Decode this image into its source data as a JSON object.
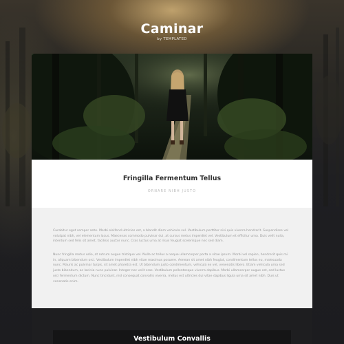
{
  "header": {
    "title": "Caminar",
    "byline": "by TEMPLATED"
  },
  "hero": {
    "image": "woman-walking-forest-path-photo"
  },
  "intro": {
    "title": "Fringilla Fermentum Tellus",
    "subtitle": "Ornare Nibh Justo"
  },
  "body": {
    "paragraphs": [
      "Curabitur eget semper ante. Morbi eleifend ultricies est, a blandit diam vehicula vel. Vestibulum porttitor nisi quis viverra hendrerit. Suspendisse vel volutpat nibh, vel elementum lacus. Maecenas commodo pulvinar dui, at cursus metus imperdiet vel. Vestibulum et efficitur urna. Duis velit nulla, interdum sed felis sit amet, facilisis auctor nunc. Cras luctus urna at risus feugiat scelerisque nec sed diam.",
      "Nunc fringilla metus odio, at rutrum augue tristique vel. Nulla ac tellus a neque ullamcorper porta a vitae ipsum. Morbi vel sapien, hendrerit quis mi in, aliquam bibendum orci. Vestibulum imperdiet nibh vitae maximus posuere. Aenean sit amet nibh feugiat, condimentum tellus eu, malesuada nunc. Mauris ac pulvinar turpis, sit amet pharetra est. Ut bibendum justo condimentum, vehicula ex vel, venenatis libero. Etiam vehicula urna sed justo bibendum, ac lacinia nunc pulvinar. Integer nec velit eros. Vestibulum pellentesque viverra dapibus. Morbi ullamcorper augue est, sed luctus orci fermentum dictum. Nunc tincidunt, nisl consequat convallis viverra, metus est ultricies dui vitae dapibus ligula urna sit amet nibh. Duis ut venenatis enim."
    ]
  },
  "dark_section": {
    "title": "Vestibulum Convallis"
  },
  "colors": {
    "page_bg": "#1b1b1d",
    "intro_bg": "#ffffff",
    "body_bg": "#f1f1f1",
    "dark_bg": "#1e1e20",
    "text_heading": "#2f2f2f",
    "text_body": "#9a9a9a"
  }
}
